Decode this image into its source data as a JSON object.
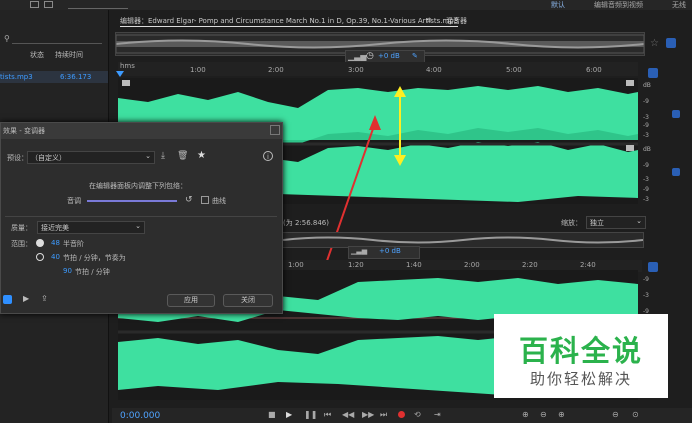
{
  "workspace": {
    "active": "默认",
    "item2": "编辑音频到视频",
    "item3": "无线"
  },
  "files_panel": {
    "col_status": "状态",
    "col_duration": "持续时间",
    "file_name": "tists.mp3",
    "file_duration": "6:36.173"
  },
  "editor": {
    "tab_title": "编辑器：Edward Elgar- Pomp and Circumstance March No.1 in D, Op.39, No.1-Various Artists.mp3",
    "tab_menu": "≡",
    "mixer_tab": "混音器"
  },
  "hud": {
    "db_value": "+0 dB"
  },
  "ruler": {
    "unit": "hms",
    "ticks": [
      "1:00",
      "2:00",
      "3:00",
      "4:00",
      "5:00",
      "6:00"
    ]
  },
  "db_scale": [
    "dB",
    "-9",
    "-3",
    "-9",
    "-3",
    "dB",
    "-9",
    "-3",
    "-9",
    "-3"
  ],
  "dialog": {
    "title": "效果 - 变调器",
    "preset_label": "预设：",
    "preset_value": "（自定义）",
    "instruction": "在编辑器面板内调整下列包络：",
    "pitch_label": "音调",
    "curve_label": "曲线",
    "quality_label": "质量：",
    "quality_value": "接近完美",
    "range_label": "范围：",
    "range_semitones_value": "48",
    "range_semitones_unit": "半音阶",
    "range_bpm_value": "40",
    "range_bpm_unit": "节拍 / 分钟，节奏为",
    "tempo_value": "90",
    "tempo_unit": "节拍 / 分钟",
    "apply": "应用",
    "close": "关闭"
  },
  "second_view": {
    "selection_info": "(为 2:56.846)",
    "zoom_label": "缩放：",
    "zoom_value": "独立",
    "hud_db": "+0 dB",
    "ticks": [
      "1:00",
      "1:20",
      "1:40",
      "2:00",
      "2:20",
      "2:40"
    ]
  },
  "transport": {
    "timecode": "0:00.000"
  },
  "watermark": {
    "main": "百科全说",
    "sub": "助你轻松解决"
  },
  "colors": {
    "waveform": "#3ee0a0",
    "accent": "#3d9bff",
    "annotation_red": "#e03030",
    "annotation_yellow": "#ffee22"
  }
}
